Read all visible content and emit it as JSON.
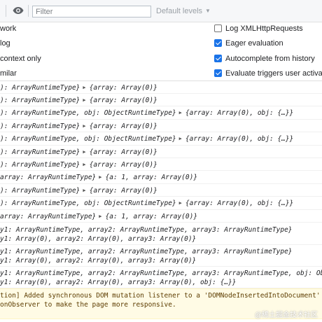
{
  "toolbar": {
    "filter_placeholder": "Filter",
    "levels_label": "Default levels"
  },
  "settings": {
    "left": [
      "work",
      "log",
      "context only",
      "milar"
    ],
    "right": [
      {
        "label": "Log XMLHttpRequests",
        "checked": false
      },
      {
        "label": "Eager evaluation",
        "checked": true
      },
      {
        "label": "Autocomplete from history",
        "checked": true
      },
      {
        "label": "Evaluate triggers user activation",
        "checked": true
      }
    ]
  },
  "console": {
    "rows": [
      {
        "lines": [
          "): ArrayRuntimeType}"
        ],
        "obj": "{array: Array(0)}"
      },
      {
        "lines": [
          "): ArrayRuntimeType}"
        ],
        "obj": "{array: Array(0)}"
      },
      {
        "lines": [
          "): ArrayRuntimeType, obj: ObjectRuntimeType}"
        ],
        "obj": "{array: Array(0), obj: {…}}"
      },
      {
        "lines": [
          "): ArrayRuntimeType}"
        ],
        "obj": "{array: Array(0)}"
      },
      {
        "lines": [
          "): ArrayRuntimeType, obj: ObjectRuntimeType}"
        ],
        "obj": "{array: Array(0), obj: {…}}"
      },
      {
        "lines": [
          "): ArrayRuntimeType}"
        ],
        "obj": "{array: Array(0)}"
      },
      {
        "lines": [
          "): ArrayRuntimeType}"
        ],
        "obj": "{array: Array(0)}"
      },
      {
        "lines": [
          "  array: ArrayRuntimeType}"
        ],
        "obj": "{a: 1, array: Array(0)}"
      },
      {
        "lines": [
          "): ArrayRuntimeType}"
        ],
        "obj": "{array: Array(0)}"
      },
      {
        "lines": [
          "): ArrayRuntimeType, obj: ObjectRuntimeType}"
        ],
        "obj": "{array: Array(0), obj: {…}}"
      },
      {
        "lines": [
          "  array: ArrayRuntimeType}"
        ],
        "obj": "{a: 1, array: Array(0)}"
      },
      {
        "lines": [
          "y1: ArrayRuntimeType, array2: ArrayRuntimeType, array3: ArrayRuntimeType}",
          "y1: Array(0), array2: Array(0), array3: Array(0)}"
        ],
        "obj": ""
      },
      {
        "lines": [
          "y1: ArrayRuntimeType, array2: ArrayRuntimeType, array3: ArrayRuntimeType}",
          "y1: Array(0), array2: Array(0), array3: Array(0)}"
        ],
        "obj": ""
      },
      {
        "lines": [
          "y1: ArrayRuntimeType, array2: ArrayRuntimeType, array3: ArrayRuntimeType, obj: Objec",
          "y1: Array(0), array2: Array(0), array3: Array(0), obj: {…}}"
        ],
        "obj": ""
      }
    ],
    "warning": [
      "tion] Added synchronous DOM mutation listener to a 'DOMNodeInsertedIntoDocument' even",
      "onObserver to make the page more responsive."
    ]
  },
  "watermark": "@稀土掘金技术社区"
}
